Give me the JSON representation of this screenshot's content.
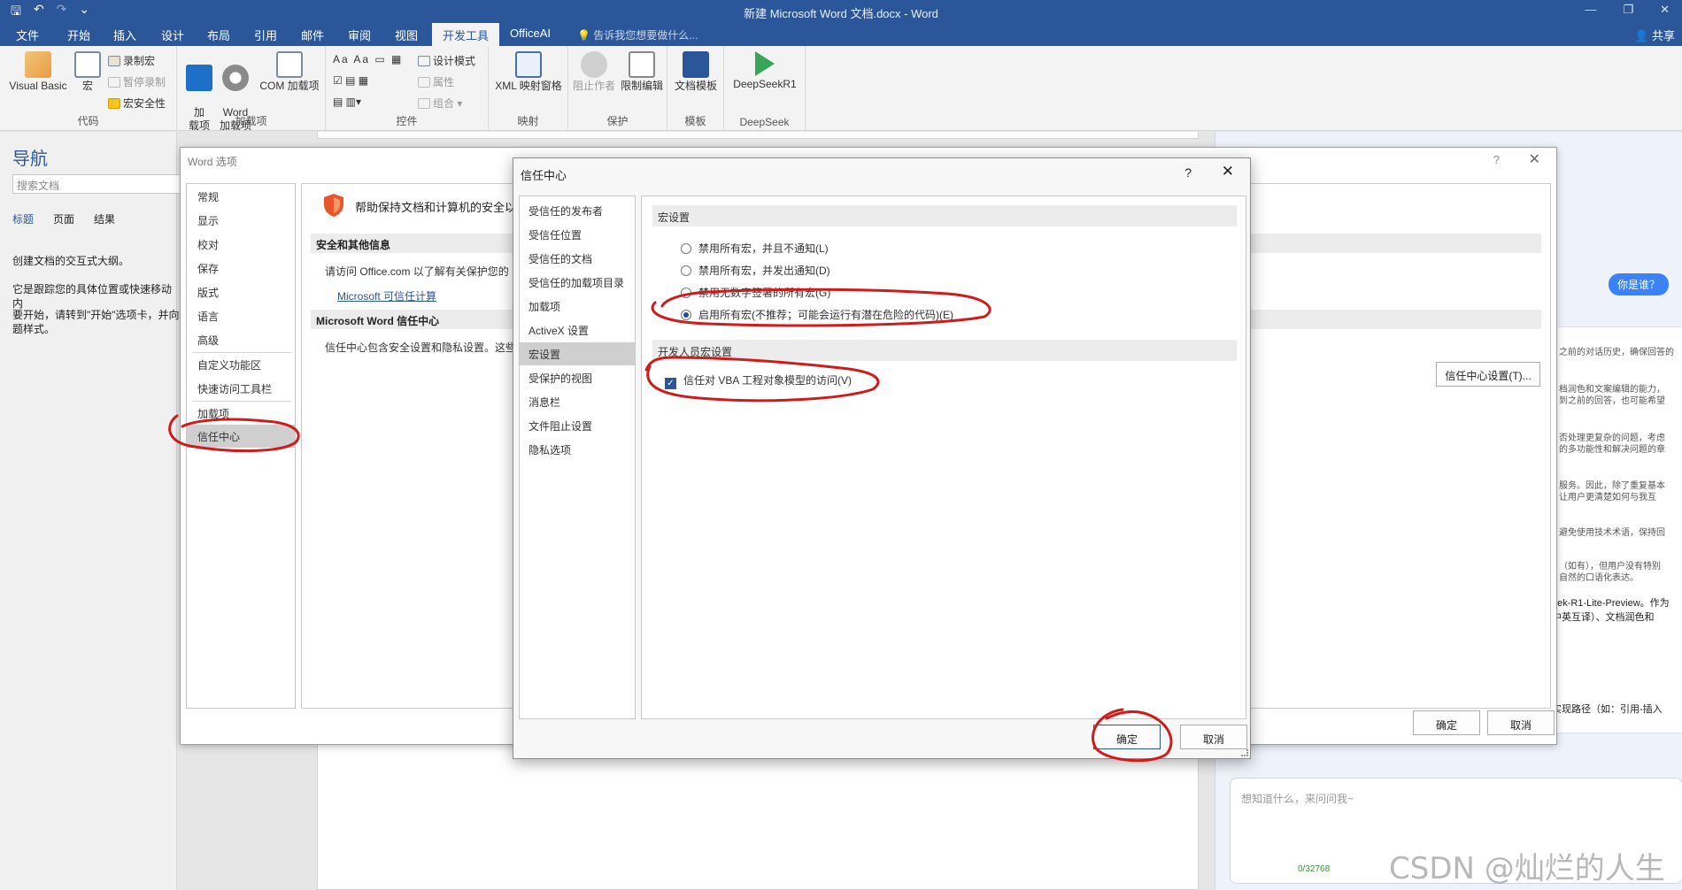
{
  "window": {
    "title": "新建 Microsoft Word 文档.docx - Word",
    "qat_save": "🖫",
    "qat_undo": "↶",
    "qat_redo": "↷",
    "qat_more": "⌄",
    "min": "—",
    "restore": "❐",
    "close": "✕"
  },
  "tabs": [
    "文件",
    "开始",
    "插入",
    "设计",
    "布局",
    "引用",
    "邮件",
    "审阅",
    "视图",
    "开发工具",
    "OfficeAI"
  ],
  "active_tab": "开发工具",
  "tell_me": "告诉我您想要做什么...",
  "share": "共享",
  "ribbon": {
    "code": {
      "label": "代码",
      "visual_basic": "Visual Basic",
      "macros": "宏",
      "record": "录制宏",
      "pause": "暂停录制",
      "security": "宏安全性"
    },
    "addins": {
      "label": "加载项",
      "addin": "加\n载项",
      "word_addin": "Word\n加载项",
      "com_addin": "COM 加载项"
    },
    "controls": {
      "label": "控件",
      "design_mode": "设计模式",
      "properties": "属性",
      "group": "组合"
    },
    "mapping": {
      "label": "映射",
      "xml": "XML 映射窗格"
    },
    "protect": {
      "label": "保护",
      "block": "阻止作者",
      "restrict": "限制编辑"
    },
    "templates": {
      "label": "模板",
      "doc_template": "文档模板"
    },
    "deepseek": {
      "label": "DeepSeek",
      "btn": "DeepSeekR1"
    }
  },
  "nav": {
    "title": "导航",
    "search_placeholder": "搜索文档",
    "tabs": [
      "标题",
      "页面",
      "结果"
    ],
    "text1": "创建文档的交互式大纲。",
    "text2": "它是跟踪您的具体位置或快速移动内",
    "text3": "要开始，请转到\"开始\"选项卡，并向",
    "text4": "题样式。"
  },
  "word_options": {
    "title": "Word 选项",
    "help": "?",
    "close": "✕",
    "items": [
      "常规",
      "显示",
      "校对",
      "保存",
      "版式",
      "语言",
      "高级",
      "自定义功能区",
      "快速访问工具栏",
      "加载项",
      "信任中心"
    ],
    "selected": "信任中心",
    "headline": "帮助保持文档和计算机的安全以",
    "sec1": "安全和其他信息",
    "sec1_text": "请访问 Office.com 以了解有关保护您的",
    "sec1_link": "Microsoft 可信任计算",
    "sec2": "Microsoft Word 信任中心",
    "sec2_text": "信任中心包含安全设置和隐私设置。这些",
    "tc_button": "信任中心设置(T)...",
    "ok": "确定",
    "cancel": "取消"
  },
  "trust_center": {
    "title": "信任中心",
    "help": "?",
    "close": "✕",
    "items": [
      "受信任的发布者",
      "受信任位置",
      "受信任的文档",
      "受信任的加载项目录",
      "加载项",
      "ActiveX 设置",
      "宏设置",
      "受保护的视图",
      "消息栏",
      "文件阻止设置",
      "隐私选项"
    ],
    "selected": "宏设置",
    "macro_section": "宏设置",
    "options": [
      "禁用所有宏，并且不通知(L)",
      "禁用所有宏，并发出通知(D)",
      "禁用无数字签署的所有宏(G)",
      "启用所有宏(不推荐；可能会运行有潜在危险的代码)(E)"
    ],
    "selected_option": 3,
    "dev_section": "开发人员宏设置",
    "vba_checkbox": "信任对 VBA 工程对象模型的访问(V)",
    "vba_checked": true,
    "ok": "确定",
    "cancel": "取消"
  },
  "chat": {
    "bubble": "你是谁？",
    "snippets": [
      "之前的对话历史，确保回答的",
      "档润色和文案编辑的能力，",
      "到之前的回答，也可能希望",
      "否处理更复杂的问题，考虑",
      "的多功能性和解决问题的章",
      "服务。因此，除了重复基本",
      "让用户更清楚如何与我互",
      "避免使用技术术语，保持回",
      "（如有），但用户没有特别",
      "自然的口语化表达。"
    ],
    "snippets_big": [
      "eek-R1-Lite-Preview。作为",
      "中英互译）、文档润色和",
      "实现路径（如：引用-插入"
    ],
    "input_placeholder": "想知道什么，来问问我~",
    "counter": "0/32768"
  },
  "watermark": "CSDN @灿烂的人生",
  "colors": {
    "word_blue": "#2b579a",
    "annotation_red": "#d11a1a"
  }
}
